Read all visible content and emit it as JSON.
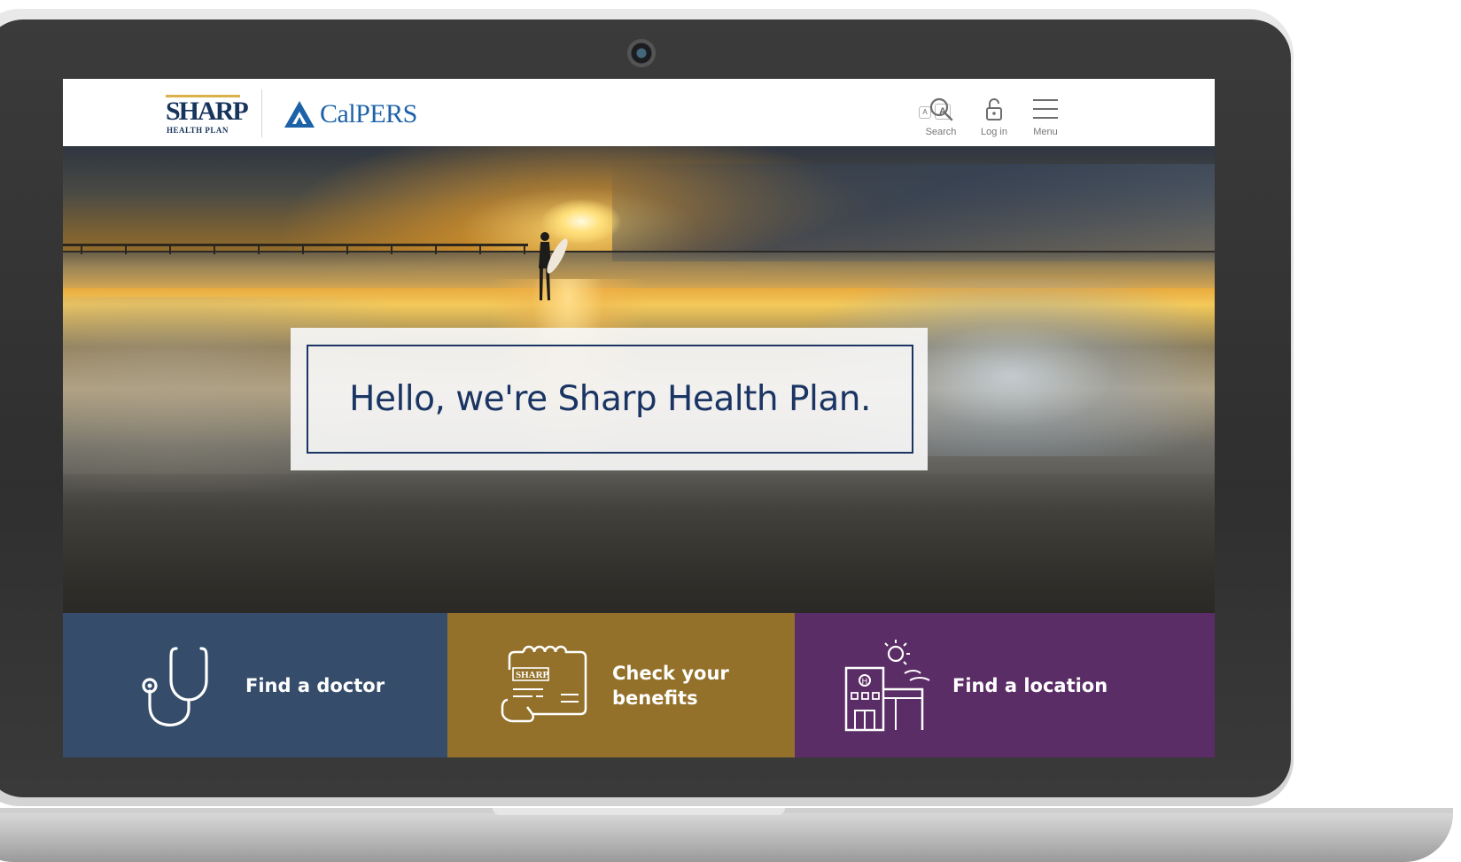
{
  "header": {
    "logos": {
      "sharp_word": "SHARP",
      "sharp_sub": "HEALTH PLAN",
      "calpers": "CalPERS"
    },
    "text_size": {
      "small": "A",
      "large": "A"
    },
    "search_label": "Search",
    "login_label": "Log in",
    "menu_label": "Menu"
  },
  "hero": {
    "title": "Hello, we're Sharp Health Plan."
  },
  "tiles": [
    {
      "label": "Find a doctor",
      "color": "#354d6b",
      "icon": "stethoscope-icon"
    },
    {
      "label_line1": "Check your",
      "label_line2": "benefits",
      "color": "#94712a",
      "icon": "member-card-icon",
      "card_text": "SHARP"
    },
    {
      "label": "Find a location",
      "color": "#5b2d66",
      "icon": "building-icon"
    }
  ],
  "colors": {
    "brand_navy": "#1a3563",
    "calpers_blue": "#1d62a8",
    "gold_accent": "#d9b24a"
  }
}
